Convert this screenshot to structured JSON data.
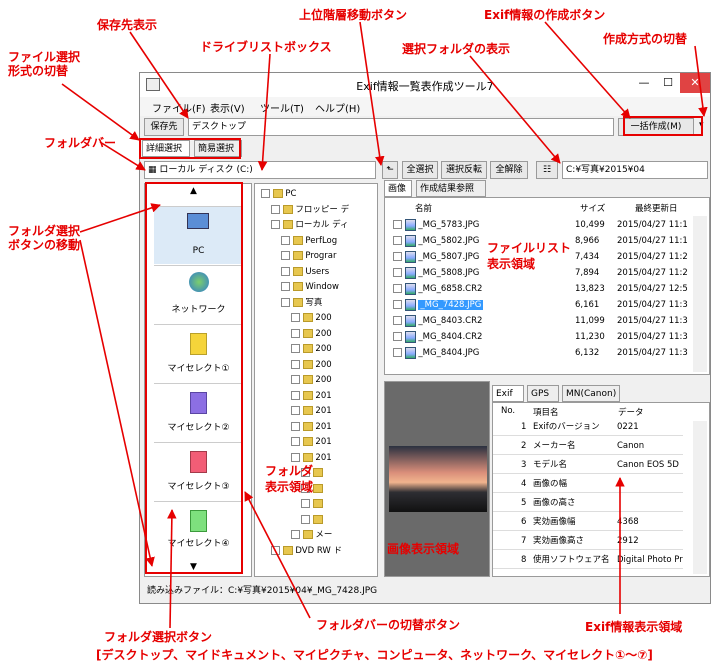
{
  "window": {
    "title": "Exif情報一覧表作成ツール7",
    "minimize": "—",
    "maximize": "☐",
    "close": "✕"
  },
  "menu": [
    "ファイル(F)",
    "表示(V)",
    "ツール(T)",
    "ヘルプ(H)"
  ],
  "save_label": "保存先",
  "save_path": "デスクトップ",
  "create_btn": "一括作成(M)",
  "mode_tabs": [
    "詳細選択",
    "簡易選択"
  ],
  "drive": "ローカル ディスク (C:)",
  "actions": [
    "全選択",
    "選択反転",
    "全解除"
  ],
  "folder_path": "C:¥写真¥2015¥04",
  "list_tabs": [
    "画像",
    "作成結果参照"
  ],
  "list_headers": [
    "名前",
    "サイズ",
    "最終更新日"
  ],
  "files": [
    {
      "name": "_MG_5783.JPG",
      "size": "10,499",
      "date": "2015/04/27 11:1"
    },
    {
      "name": "_MG_5802.JPG",
      "size": "8,966",
      "date": "2015/04/27 11:1"
    },
    {
      "name": "_MG_5807.JPG",
      "size": "7,434",
      "date": "2015/04/27 11:2"
    },
    {
      "name": "_MG_5808.JPG",
      "size": "7,894",
      "date": "2015/04/27 11:2"
    },
    {
      "name": "_MG_6858.CR2",
      "size": "13,823",
      "date": "2015/04/27 12:5"
    },
    {
      "name": "_MG_7428.JPG",
      "size": "6,161",
      "date": "2015/04/27 11:3"
    },
    {
      "name": "_MG_8403.CR2",
      "size": "11,099",
      "date": "2015/04/27 11:3"
    },
    {
      "name": "_MG_8404.CR2",
      "size": "11,230",
      "date": "2015/04/27 11:3"
    },
    {
      "name": "_MG_8404.JPG",
      "size": "6,132",
      "date": "2015/04/27 11:3"
    }
  ],
  "folderbar": [
    "PC",
    "ネットワーク",
    "マイセレクト①",
    "マイセレクト②",
    "マイセレクト③",
    "マイセレクト④"
  ],
  "tree": [
    {
      "label": "PC",
      "indent": 0
    },
    {
      "label": "フロッピー デ",
      "indent": 1
    },
    {
      "label": "ローカル ディ",
      "indent": 1
    },
    {
      "label": "PerfLog",
      "indent": 2
    },
    {
      "label": "Prograr",
      "indent": 2
    },
    {
      "label": "Users",
      "indent": 2
    },
    {
      "label": "Window",
      "indent": 2
    },
    {
      "label": "写真",
      "indent": 2
    },
    {
      "label": "200",
      "indent": 3
    },
    {
      "label": "200",
      "indent": 3
    },
    {
      "label": "200",
      "indent": 3
    },
    {
      "label": "200",
      "indent": 3
    },
    {
      "label": "200",
      "indent": 3
    },
    {
      "label": "201",
      "indent": 3
    },
    {
      "label": "201",
      "indent": 3
    },
    {
      "label": "201",
      "indent": 3
    },
    {
      "label": "201",
      "indent": 3
    },
    {
      "label": "201",
      "indent": 3
    },
    {
      "label": "",
      "indent": 4
    },
    {
      "label": "",
      "indent": 4
    },
    {
      "label": "",
      "indent": 4
    },
    {
      "label": "",
      "indent": 4
    },
    {
      "label": "メー",
      "indent": 3
    },
    {
      "label": "DVD RW ド",
      "indent": 1
    }
  ],
  "exif_tabs": [
    "Exif",
    "GPS",
    "MN(Canon)"
  ],
  "exif_headers": [
    "No.",
    "項目名",
    "データ"
  ],
  "exif_rows": [
    {
      "no": "1",
      "name": "Exifのバージョン",
      "val": "0221"
    },
    {
      "no": "2",
      "name": "メーカー名",
      "val": "Canon"
    },
    {
      "no": "3",
      "name": "モデル名",
      "val": "Canon EOS 5D"
    },
    {
      "no": "4",
      "name": "画像の幅",
      "val": ""
    },
    {
      "no": "5",
      "name": "画像の高さ",
      "val": ""
    },
    {
      "no": "6",
      "name": "実効画像幅",
      "val": "4368"
    },
    {
      "no": "7",
      "name": "実効画像高さ",
      "val": "2912"
    },
    {
      "no": "8",
      "name": "使用ソフトウェア名",
      "val": "Digital Photo Pr"
    }
  ],
  "status": "読み込みファイル：C:¥写真¥2015¥04¥_MG_7428.JPG",
  "annotations": {
    "save": "保存先表示",
    "selfmt": "ファイル選択\n形式の切替",
    "drive": "ドライブリストボックス",
    "up": "上位階層移動ボタン",
    "exifbtn": "Exif情報の作成ボタン",
    "method": "作成方式の切替",
    "folderdisp": "選択フォルダの表示",
    "folderbar": "フォルダバー",
    "fbmove": "フォルダ選択\nボタンの移動",
    "filelist": "ファイルリスト\n表示領域",
    "folderarea": "フォルダ\n表示領域",
    "imgarea": "画像表示領域",
    "fbswitch": "フォルダバーの切替ボタン",
    "exifarea": "Exif情報表示領域",
    "fbbtn": "フォルダ選択ボタン",
    "fbbtn_list": "[デスクトップ、マイドキュメント、マイピクチャ、コンピュータ、ネットワーク、マイセレクト①～⑦]"
  },
  "colors": {
    "annotation": "#e60000",
    "selection": "#3399ff"
  }
}
